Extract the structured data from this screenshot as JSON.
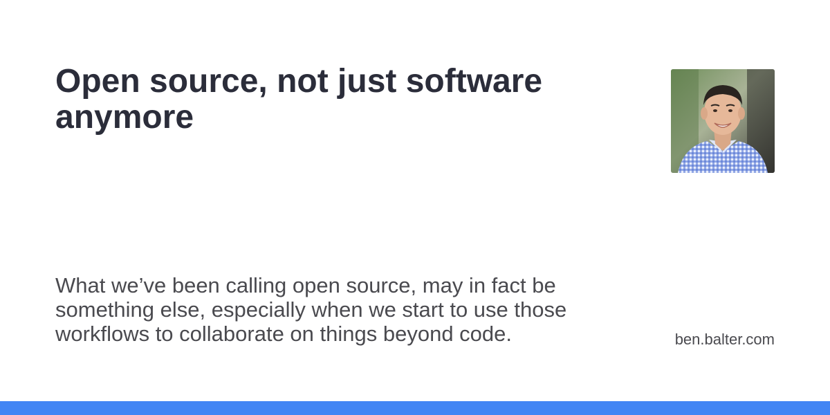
{
  "card": {
    "title": "Open source, not just software anymore",
    "description": "What we’ve been calling open source, may in fact be something else, especially when we start to use those workflows to collaborate on things beyond code.",
    "domain": "ben.balter.com"
  },
  "avatar": {
    "icon": "person-photo-icon"
  },
  "colors": {
    "accent_bar": "#4285f4",
    "title_text": "#2b2d3a",
    "body_text": "#4a4a4f",
    "background": "#ffffff"
  }
}
